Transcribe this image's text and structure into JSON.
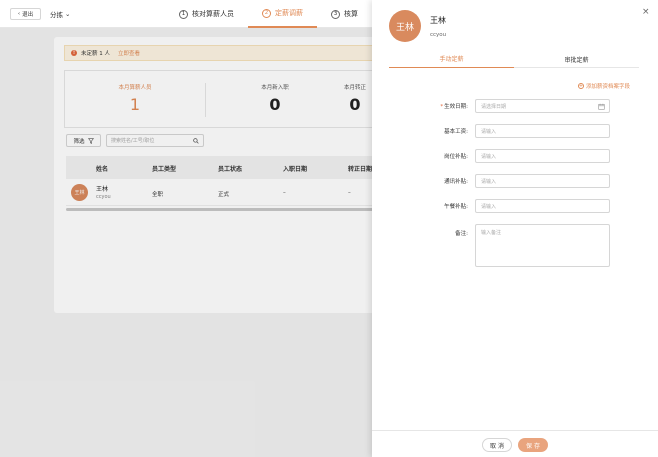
{
  "topbar": {
    "back_label": "退出",
    "company": "分拣",
    "steps": [
      {
        "num": "①",
        "label": "核对算薪人员"
      },
      {
        "num": "②",
        "label": "定薪调薪"
      },
      {
        "num": "③",
        "label": "核算"
      }
    ]
  },
  "notice": {
    "text": "未定薪 1 人",
    "link": "立即查看",
    "icon": "!"
  },
  "stats": [
    {
      "label": "本月算薪人员",
      "value": "1"
    },
    {
      "label": "本月新入职",
      "value": "0"
    },
    {
      "label": "本月转正",
      "value": "0"
    }
  ],
  "toolbar": {
    "filter_label": "筛选",
    "search_placeholder": "搜索姓名/工号/职位"
  },
  "table": {
    "headers": [
      "姓名",
      "员工类型",
      "员工状态",
      "入职日期",
      "转正日期"
    ],
    "rows": [
      {
        "avatar": "王林",
        "name": "王林",
        "sub": "ccyou",
        "type": "全职",
        "status": "正式",
        "join": "–",
        "regular": "–"
      }
    ]
  },
  "drawer": {
    "avatar": "王林",
    "name": "王林",
    "sub": "ccyou",
    "close": "×",
    "tabs": [
      "手动定薪",
      "审批定薪"
    ],
    "add_link": "添加薪资档案字段",
    "fields": [
      {
        "label": "生效日期:",
        "placeholder": "请选择日期",
        "required": "*"
      },
      {
        "label": "基本工资:",
        "placeholder": "请输入"
      },
      {
        "label": "岗位补贴:",
        "placeholder": "请输入"
      },
      {
        "label": "通讯补贴:",
        "placeholder": "请输入"
      },
      {
        "label": "午餐补贴:",
        "placeholder": "请输入"
      }
    ],
    "note": {
      "label": "备注:",
      "placeholder": "输入备注"
    },
    "cancel_label": "取 消",
    "save_label": "保 存"
  },
  "colors": {
    "accent": "#e08a55",
    "avatar_bg": "#d98a5e",
    "save_bg": "#e9a47e",
    "warn_bg": "#fdf4e3"
  }
}
